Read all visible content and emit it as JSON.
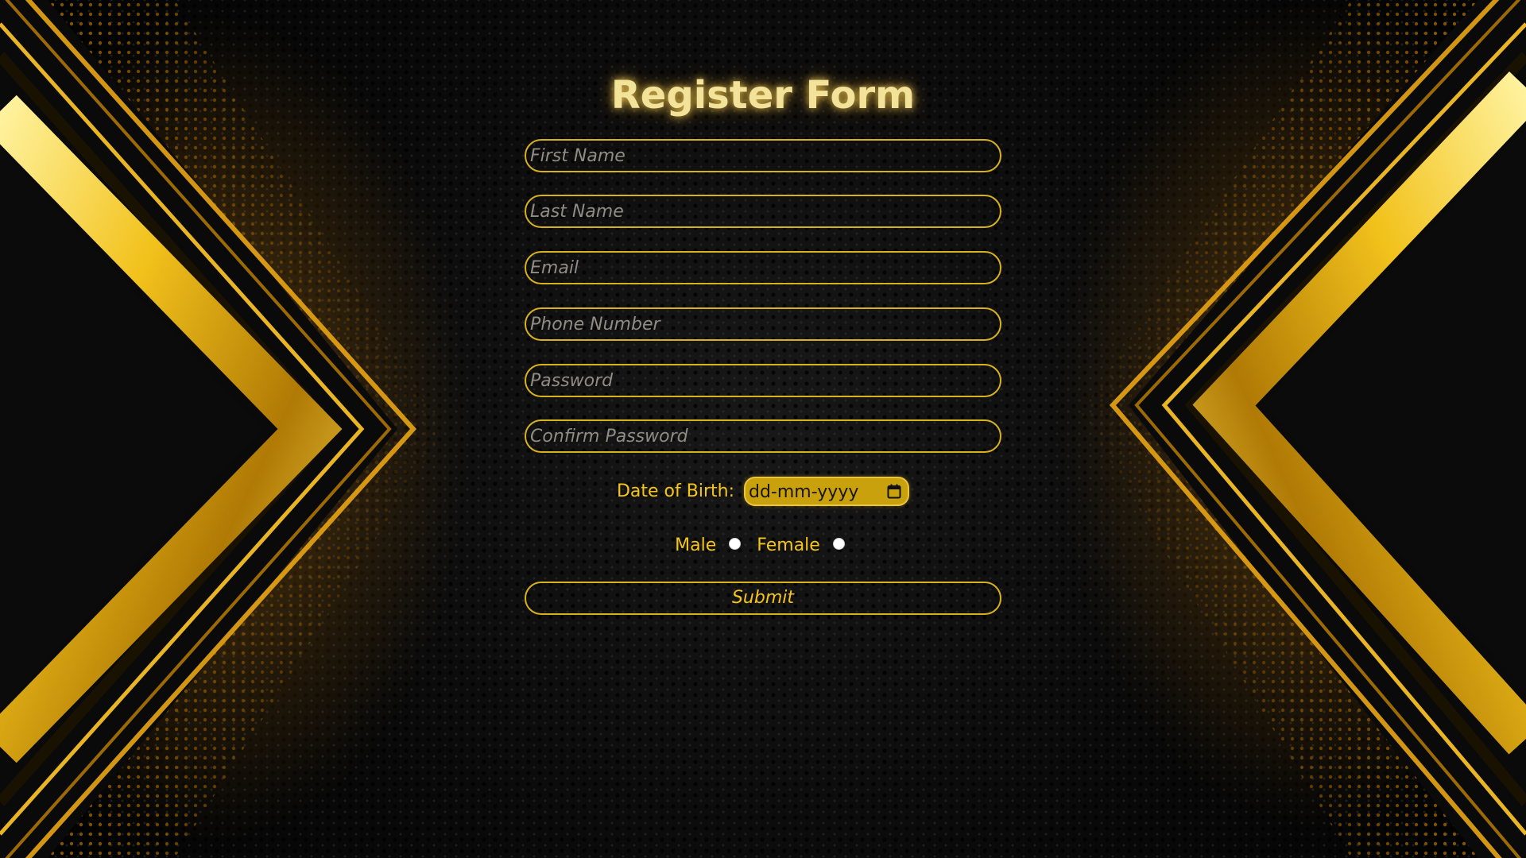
{
  "form": {
    "title": "Register Form",
    "fields": [
      {
        "placeholder": "First Name"
      },
      {
        "placeholder": "Last Name"
      },
      {
        "placeholder": "Email"
      },
      {
        "placeholder": "Phone Number"
      },
      {
        "placeholder": "Password"
      },
      {
        "placeholder": "Confirm Password"
      }
    ],
    "dob": {
      "label": "Date of Birth:",
      "placeholder": "dd-mm-yyyy"
    },
    "gender": {
      "male_label": "Male",
      "female_label": "Female"
    },
    "submit_label": "Submit"
  },
  "colors": {
    "accent": "#f5c518",
    "border": "#d7b21a",
    "title": "#f3e39a",
    "background": "#050505"
  }
}
